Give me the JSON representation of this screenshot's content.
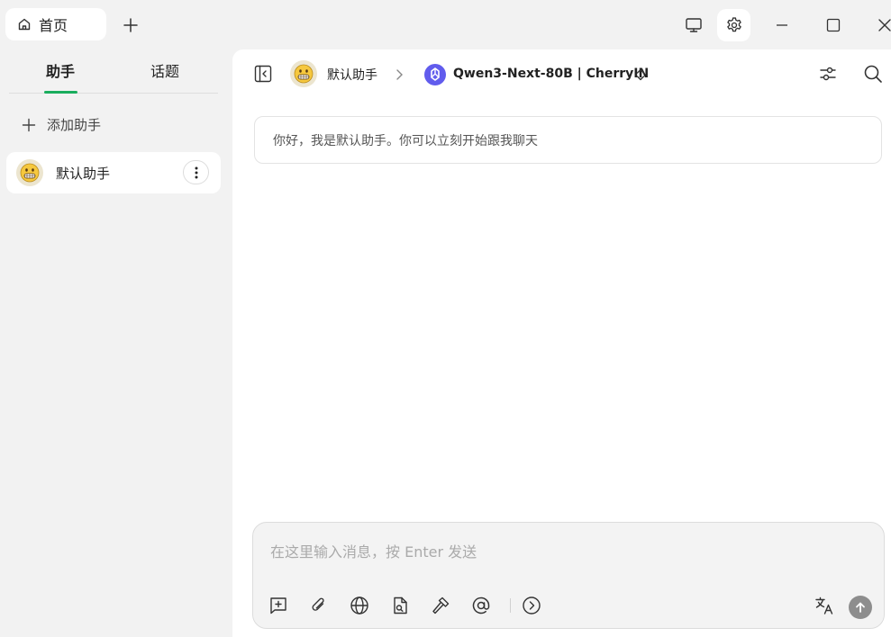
{
  "titlebar": {
    "home_tab_label": "首页",
    "icons": [
      "home-icon",
      "plus-icon",
      "monitor-icon",
      "gear-icon",
      "minimize-icon",
      "maximize-icon",
      "close-icon"
    ]
  },
  "sidebar": {
    "tabs": [
      {
        "label": "助手",
        "active": true
      },
      {
        "label": "话题",
        "active": false
      }
    ],
    "add_assistant_label": "添加助手",
    "assistants": [
      {
        "name": "默认助手",
        "avatar": "grinning-face-emoji"
      }
    ],
    "accent_color": "#1aad5d"
  },
  "main": {
    "breadcrumb": {
      "assistant_name": "默认助手",
      "model_name": "Qwen3-Next-80B | CherryIN"
    },
    "welcome_message": "你好，我是默认助手。你可以立刻开始跟我聊天",
    "composer": {
      "placeholder": "在这里输入消息，按 Enter 发送",
      "tools": [
        "new-topic-icon",
        "attachment-icon",
        "web-search-icon",
        "file-search-icon",
        "tools-hammer-icon",
        "mention-icon",
        "expand-arrow-icon"
      ],
      "right_tools": [
        "translate-icon",
        "send-icon"
      ]
    }
  }
}
